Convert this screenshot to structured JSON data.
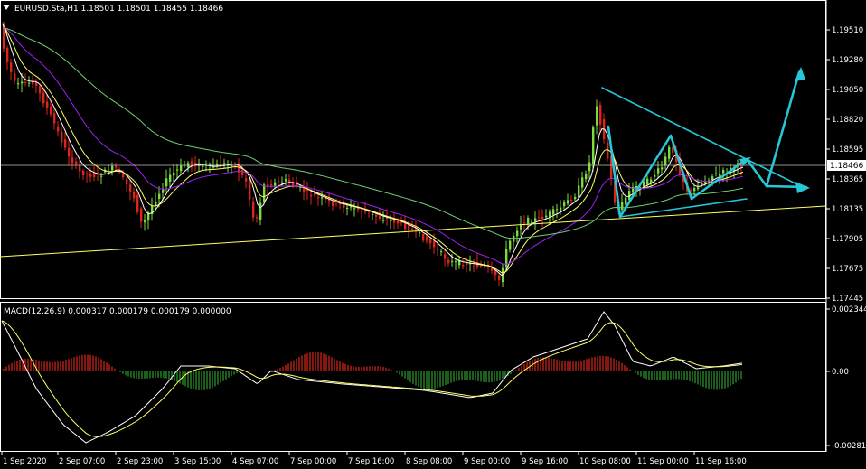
{
  "window": {
    "symbol_info": "EURUSD.Sta,H1  1.18501 1.18501 1.18455 1.18466",
    "dropdown_icon": "triangle-down-icon"
  },
  "main_chart": {
    "price_ticks": [
      "1.19510",
      "1.19280",
      "1.19050",
      "1.18820",
      "1.18595",
      "1.18365",
      "1.18135",
      "1.17905",
      "1.17675",
      "1.17445"
    ],
    "current_price": "1.18466",
    "colors": {
      "bull": "#7cdc3c",
      "bear": "#e0241c",
      "ma_yellow": "#ffff66",
      "ma_white": "#ffffff",
      "ma_purple": "#a020f0",
      "ma_green": "#6fcf6f",
      "trendline": "#ffff66",
      "drawing": "#27c6d6",
      "grid_line": "#c0c0c0"
    }
  },
  "macd": {
    "label": "MACD(12,26,9) 0.000317 0.000179 0.000179 0.000000",
    "ticks": [
      "0.002344",
      "0.00",
      "-0.002814"
    ]
  },
  "time_axis": [
    "1 Sep 2020",
    "2 Sep 07:00",
    "2 Sep 23:00",
    "3 Sep 15:00",
    "4 Sep 07:00",
    "7 Sep 00:00",
    "7 Sep 16:00",
    "8 Sep 08:00",
    "9 Sep 00:00",
    "9 Sep 16:00",
    "10 Sep 08:00",
    "11 Sep 00:00",
    "11 Sep 16:00"
  ]
}
